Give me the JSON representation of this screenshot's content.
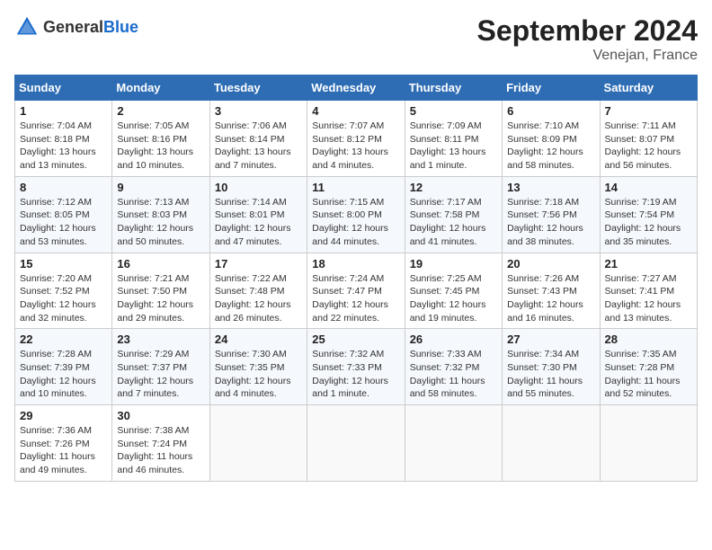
{
  "header": {
    "logo_general": "General",
    "logo_blue": "Blue",
    "title": "September 2024",
    "subtitle": "Venejan, France"
  },
  "calendar": {
    "columns": [
      "Sunday",
      "Monday",
      "Tuesday",
      "Wednesday",
      "Thursday",
      "Friday",
      "Saturday"
    ],
    "weeks": [
      [
        null,
        null,
        null,
        null,
        null,
        null,
        null
      ]
    ],
    "days": [
      {
        "date": 1,
        "col": 0,
        "sunrise": "7:04 AM",
        "sunset": "8:18 PM",
        "daylight": "Daylight: 13 hours and 13 minutes."
      },
      {
        "date": 2,
        "col": 1,
        "sunrise": "7:05 AM",
        "sunset": "8:16 PM",
        "daylight": "Daylight: 13 hours and 10 minutes."
      },
      {
        "date": 3,
        "col": 2,
        "sunrise": "7:06 AM",
        "sunset": "8:14 PM",
        "daylight": "Daylight: 13 hours and 7 minutes."
      },
      {
        "date": 4,
        "col": 3,
        "sunrise": "7:07 AM",
        "sunset": "8:12 PM",
        "daylight": "Daylight: 13 hours and 4 minutes."
      },
      {
        "date": 5,
        "col": 4,
        "sunrise": "7:09 AM",
        "sunset": "8:11 PM",
        "daylight": "Daylight: 13 hours and 1 minute."
      },
      {
        "date": 6,
        "col": 5,
        "sunrise": "7:10 AM",
        "sunset": "8:09 PM",
        "daylight": "Daylight: 12 hours and 58 minutes."
      },
      {
        "date": 7,
        "col": 6,
        "sunrise": "7:11 AM",
        "sunset": "8:07 PM",
        "daylight": "Daylight: 12 hours and 56 minutes."
      },
      {
        "date": 8,
        "col": 0,
        "sunrise": "7:12 AM",
        "sunset": "8:05 PM",
        "daylight": "Daylight: 12 hours and 53 minutes."
      },
      {
        "date": 9,
        "col": 1,
        "sunrise": "7:13 AM",
        "sunset": "8:03 PM",
        "daylight": "Daylight: 12 hours and 50 minutes."
      },
      {
        "date": 10,
        "col": 2,
        "sunrise": "7:14 AM",
        "sunset": "8:01 PM",
        "daylight": "Daylight: 12 hours and 47 minutes."
      },
      {
        "date": 11,
        "col": 3,
        "sunrise": "7:15 AM",
        "sunset": "8:00 PM",
        "daylight": "Daylight: 12 hours and 44 minutes."
      },
      {
        "date": 12,
        "col": 4,
        "sunrise": "7:17 AM",
        "sunset": "7:58 PM",
        "daylight": "Daylight: 12 hours and 41 minutes."
      },
      {
        "date": 13,
        "col": 5,
        "sunrise": "7:18 AM",
        "sunset": "7:56 PM",
        "daylight": "Daylight: 12 hours and 38 minutes."
      },
      {
        "date": 14,
        "col": 6,
        "sunrise": "7:19 AM",
        "sunset": "7:54 PM",
        "daylight": "Daylight: 12 hours and 35 minutes."
      },
      {
        "date": 15,
        "col": 0,
        "sunrise": "7:20 AM",
        "sunset": "7:52 PM",
        "daylight": "Daylight: 12 hours and 32 minutes."
      },
      {
        "date": 16,
        "col": 1,
        "sunrise": "7:21 AM",
        "sunset": "7:50 PM",
        "daylight": "Daylight: 12 hours and 29 minutes."
      },
      {
        "date": 17,
        "col": 2,
        "sunrise": "7:22 AM",
        "sunset": "7:48 PM",
        "daylight": "Daylight: 12 hours and 26 minutes."
      },
      {
        "date": 18,
        "col": 3,
        "sunrise": "7:24 AM",
        "sunset": "7:47 PM",
        "daylight": "Daylight: 12 hours and 22 minutes."
      },
      {
        "date": 19,
        "col": 4,
        "sunrise": "7:25 AM",
        "sunset": "7:45 PM",
        "daylight": "Daylight: 12 hours and 19 minutes."
      },
      {
        "date": 20,
        "col": 5,
        "sunrise": "7:26 AM",
        "sunset": "7:43 PM",
        "daylight": "Daylight: 12 hours and 16 minutes."
      },
      {
        "date": 21,
        "col": 6,
        "sunrise": "7:27 AM",
        "sunset": "7:41 PM",
        "daylight": "Daylight: 12 hours and 13 minutes."
      },
      {
        "date": 22,
        "col": 0,
        "sunrise": "7:28 AM",
        "sunset": "7:39 PM",
        "daylight": "Daylight: 12 hours and 10 minutes."
      },
      {
        "date": 23,
        "col": 1,
        "sunrise": "7:29 AM",
        "sunset": "7:37 PM",
        "daylight": "Daylight: 12 hours and 7 minutes."
      },
      {
        "date": 24,
        "col": 2,
        "sunrise": "7:30 AM",
        "sunset": "7:35 PM",
        "daylight": "Daylight: 12 hours and 4 minutes."
      },
      {
        "date": 25,
        "col": 3,
        "sunrise": "7:32 AM",
        "sunset": "7:33 PM",
        "daylight": "Daylight: 12 hours and 1 minute."
      },
      {
        "date": 26,
        "col": 4,
        "sunrise": "7:33 AM",
        "sunset": "7:32 PM",
        "daylight": "Daylight: 11 hours and 58 minutes."
      },
      {
        "date": 27,
        "col": 5,
        "sunrise": "7:34 AM",
        "sunset": "7:30 PM",
        "daylight": "Daylight: 11 hours and 55 minutes."
      },
      {
        "date": 28,
        "col": 6,
        "sunrise": "7:35 AM",
        "sunset": "7:28 PM",
        "daylight": "Daylight: 11 hours and 52 minutes."
      },
      {
        "date": 29,
        "col": 0,
        "sunrise": "7:36 AM",
        "sunset": "7:26 PM",
        "daylight": "Daylight: 11 hours and 49 minutes."
      },
      {
        "date": 30,
        "col": 1,
        "sunrise": "7:38 AM",
        "sunset": "7:24 PM",
        "daylight": "Daylight: 11 hours and 46 minutes."
      }
    ]
  }
}
